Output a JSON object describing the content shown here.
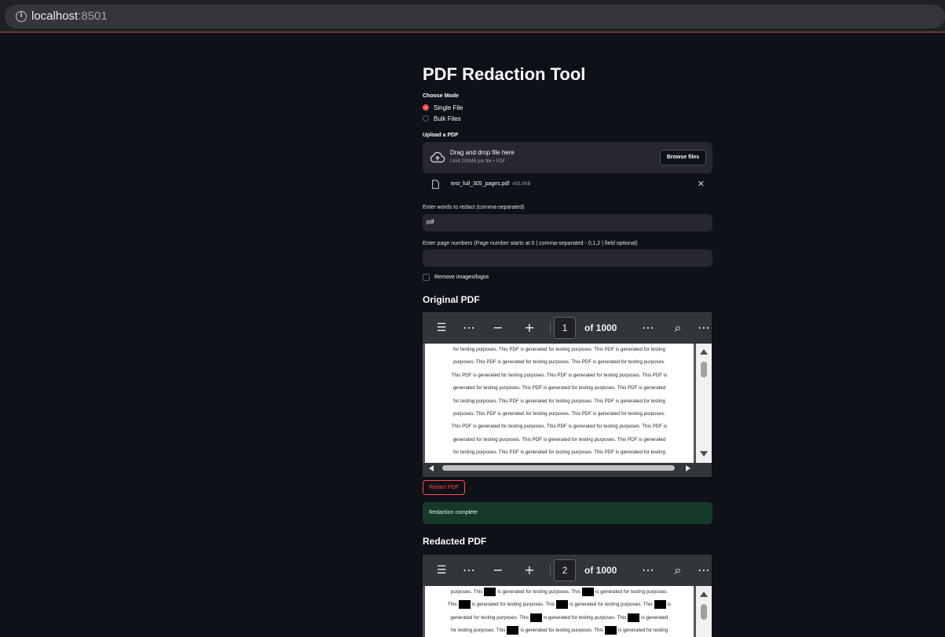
{
  "browser": {
    "host": "localhost",
    "port": ":8501",
    "info_icon": "info-icon"
  },
  "app": {
    "title": "PDF Redaction Tool",
    "mode": {
      "label": "Choose Mode",
      "options": [
        "Single File",
        "Bulk Files"
      ],
      "selected": "Single File"
    },
    "uploader": {
      "label": "Upload a PDF",
      "dropzone_title": "Drag and drop file here",
      "dropzone_sub": "Limit 200MB per file • PDF",
      "browse_label": "Browse files",
      "file_name": "test_full_305_pages.pdf",
      "file_size": "493.0KB"
    },
    "words": {
      "label": "Enter words to redact (comma-separated)",
      "value": "pdf"
    },
    "pages": {
      "label": "Enter page numbers (Page number starts at 0 | comma-separated - 0,1,2 | field optional)",
      "value": ""
    },
    "remove_images": {
      "label": "Remove images/logos",
      "checked": false
    },
    "original": {
      "heading": "Original PDF",
      "page": "1",
      "of_pages": "of 1000",
      "lines": [
        "for testing purposes. This PDF is generated for testing purposes. This PDF is generated for testing",
        "purposes. This PDF is generated for testing purposes. This PDF is generated for testing purposes.",
        "This PDF is generated for testing purposes. This PDF is generated for testing purposes. This PDF is",
        "generated for testing purposes. This PDF is generated for testing purposes. This PDF is generated",
        "for testing purposes. This PDF is generated for testing purposes. This PDF is generated for testing",
        "purposes. This PDF is generated for testing purposes. This PDF is generated for testing purposes.",
        "This PDF is generated for testing purposes. This PDF is generated for testing purposes. This PDF is",
        "generated for testing purposes. This PDF is generated for testing purposes. This PDF is generated",
        "for testing purposes. This PDF is generated for testing purposes. This PDF is generated for testing"
      ]
    },
    "redact_button": "Redact PDF",
    "status": "Redaction complete",
    "redacted": {
      "heading": "Redacted PDF",
      "page": "2",
      "of_pages": "of 1000",
      "lines": [
        [
          "purposes. This",
          "is generated for testing purposes. This",
          "is generated for testing purposes."
        ],
        [
          "This",
          "is generated for testing purposes. This",
          "is generated for testing purposes. This",
          "is"
        ],
        [
          "generated for testing purposes. This",
          "is generated for testing purposes. This",
          "is generated"
        ],
        [
          "for testing purposes. This",
          "is generated for testing purposes. This",
          "is generated for testing"
        ]
      ]
    }
  },
  "toolbar_icons": [
    "outline-icon",
    "more-icon",
    "zoom-out-icon",
    "zoom-in-icon",
    "more-icon",
    "search-icon",
    "more-icon"
  ],
  "colors": {
    "background": "#0e1117",
    "accent": "#ff4b4b",
    "success_bg": "#173928",
    "input_bg": "#262730"
  }
}
